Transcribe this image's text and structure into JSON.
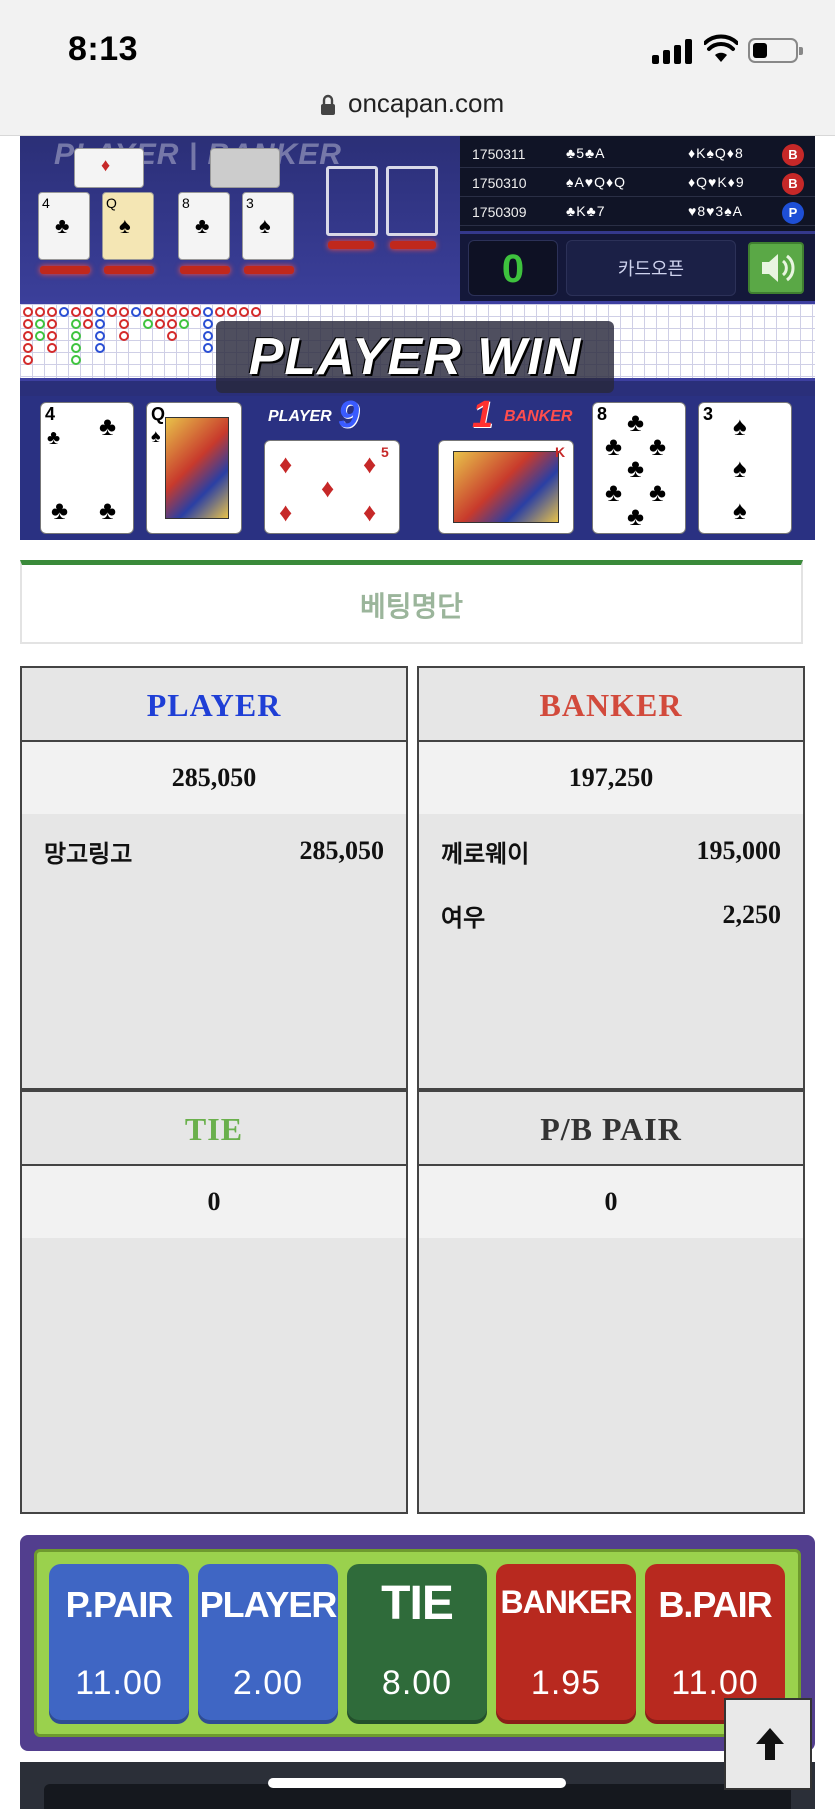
{
  "status_bar": {
    "time": "8:13"
  },
  "browser": {
    "url": "oncapan.com"
  },
  "game": {
    "logo_player": "PLAYER",
    "logo_banker": "BANKER",
    "history": [
      {
        "id": "1750311",
        "player_cards": "♣5♣A",
        "banker_cards": "♦K♠Q♦8",
        "result": "B"
      },
      {
        "id": "1750310",
        "player_cards": "♠A♥Q♦Q",
        "banker_cards": "♦Q♥K♦9",
        "result": "B"
      },
      {
        "id": "1750309",
        "player_cards": "♣K♣7",
        "banker_cards": "♥8♥3♠A",
        "result": "P"
      }
    ],
    "count": "0",
    "card_open_label": "카드오픈",
    "win_banner": "PLAYER WIN",
    "player_label": "PLAYER",
    "player_score": "9",
    "banker_label": "BANKER",
    "banker_score": "1",
    "player_cards": [
      {
        "rank": "4",
        "suit": "♣",
        "color": "#111111"
      },
      {
        "rank": "Q",
        "suit": "♠",
        "color": "#111111"
      },
      {
        "rank": "5",
        "suit": "♦",
        "color": "#c62828"
      }
    ],
    "banker_cards": [
      {
        "rank": "K",
        "suit": "♦",
        "color": "#c62828"
      },
      {
        "rank": "8",
        "suit": "♣",
        "color": "#111111"
      },
      {
        "rank": "3",
        "suit": "♠",
        "color": "#111111"
      }
    ]
  },
  "betting": {
    "title": "베팅명단",
    "player": {
      "label": "PLAYER",
      "color": "#1f3fd6",
      "total": "285,050",
      "entries": [
        {
          "name": "망고링고",
          "amount": "285,050"
        }
      ]
    },
    "banker": {
      "label": "BANKER",
      "color": "#d24a3c",
      "total": "197,250",
      "entries": [
        {
          "name": "께로웨이",
          "amount": "195,000"
        },
        {
          "name": "여우",
          "amount": "2,250"
        }
      ]
    },
    "tie": {
      "label": "TIE",
      "color": "#6ab04c",
      "total": "0"
    },
    "pair": {
      "label": "P/B PAIR",
      "color": "#333333",
      "total": "0"
    }
  },
  "odds": [
    {
      "label": "P.PAIR",
      "value": "11.00",
      "color": "blue"
    },
    {
      "label": "PLAYER",
      "value": "2.00",
      "color": "blue"
    },
    {
      "label": "TIE",
      "value": "8.00",
      "color": "green"
    },
    {
      "label": "BANKER",
      "value": "1.95",
      "color": "red"
    },
    {
      "label": "B.PAIR",
      "value": "11.00",
      "color": "red"
    }
  ],
  "icons": {
    "lock": "lock-icon",
    "sound": "speaker-icon",
    "scroll_top": "arrow-up-icon"
  }
}
